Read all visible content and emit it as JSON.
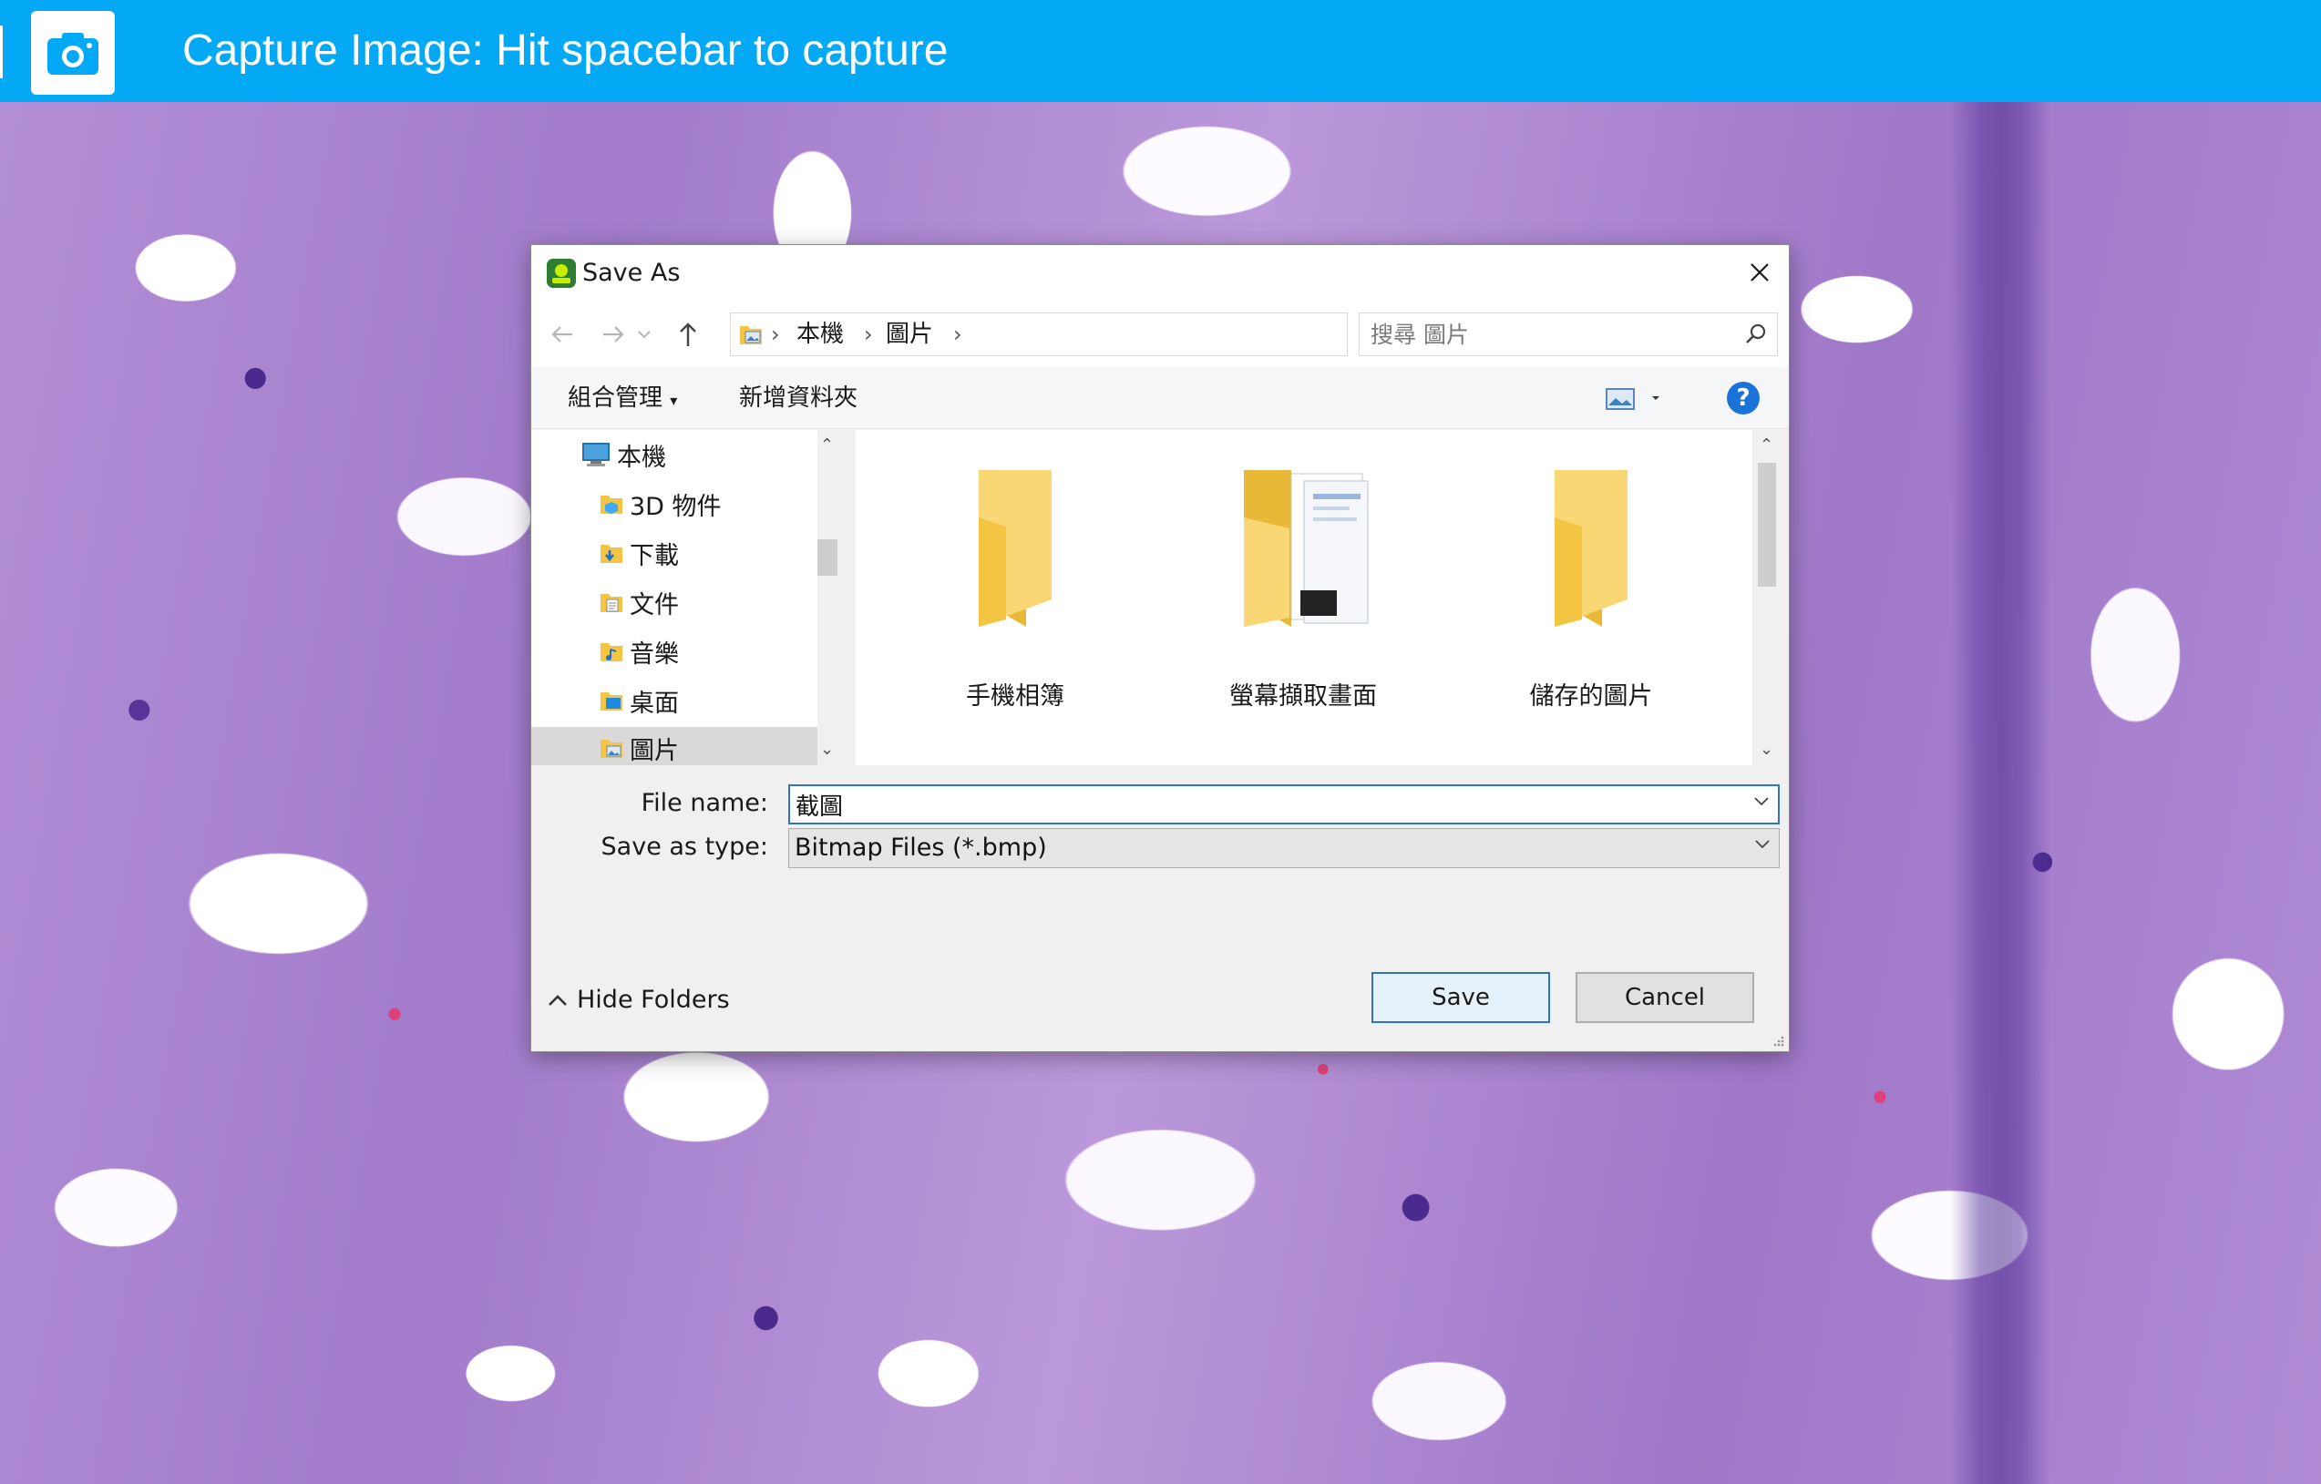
{
  "capture_bar": {
    "title": "Capture Image: Hit spacebar to capture",
    "icon": "camera-icon",
    "color": "#03a9f4"
  },
  "dialog": {
    "title": "Save As",
    "address": {
      "breadcrumbs": [
        "本機",
        "圖片"
      ]
    },
    "search": {
      "placeholder": "搜尋 圖片"
    },
    "commands": {
      "organize": "組合管理",
      "new_folder": "新增資料夾",
      "help": "?"
    },
    "nav_tree": [
      {
        "label": "本機",
        "icon": "computer-icon"
      },
      {
        "label": "3D 物件",
        "icon": "3d-objects-folder-icon"
      },
      {
        "label": "下載",
        "icon": "downloads-folder-icon"
      },
      {
        "label": "文件",
        "icon": "documents-folder-icon"
      },
      {
        "label": "音樂",
        "icon": "music-folder-icon"
      },
      {
        "label": "桌面",
        "icon": "desktop-folder-icon"
      },
      {
        "label": "圖片",
        "icon": "pictures-folder-icon",
        "selected": true
      }
    ],
    "files": [
      {
        "label": "手機相簿",
        "icon": "folder-icon"
      },
      {
        "label": "螢幕擷取畫面",
        "icon": "folder-with-files-icon"
      },
      {
        "label": "儲存的圖片",
        "icon": "folder-icon"
      }
    ],
    "file_name": {
      "label": "File name:",
      "value": "截圖"
    },
    "save_type": {
      "label": "Save as type:",
      "value": "Bitmap Files (*.bmp)"
    },
    "hide_folders": "Hide Folders",
    "save_button": "Save",
    "cancel_button": "Cancel"
  }
}
